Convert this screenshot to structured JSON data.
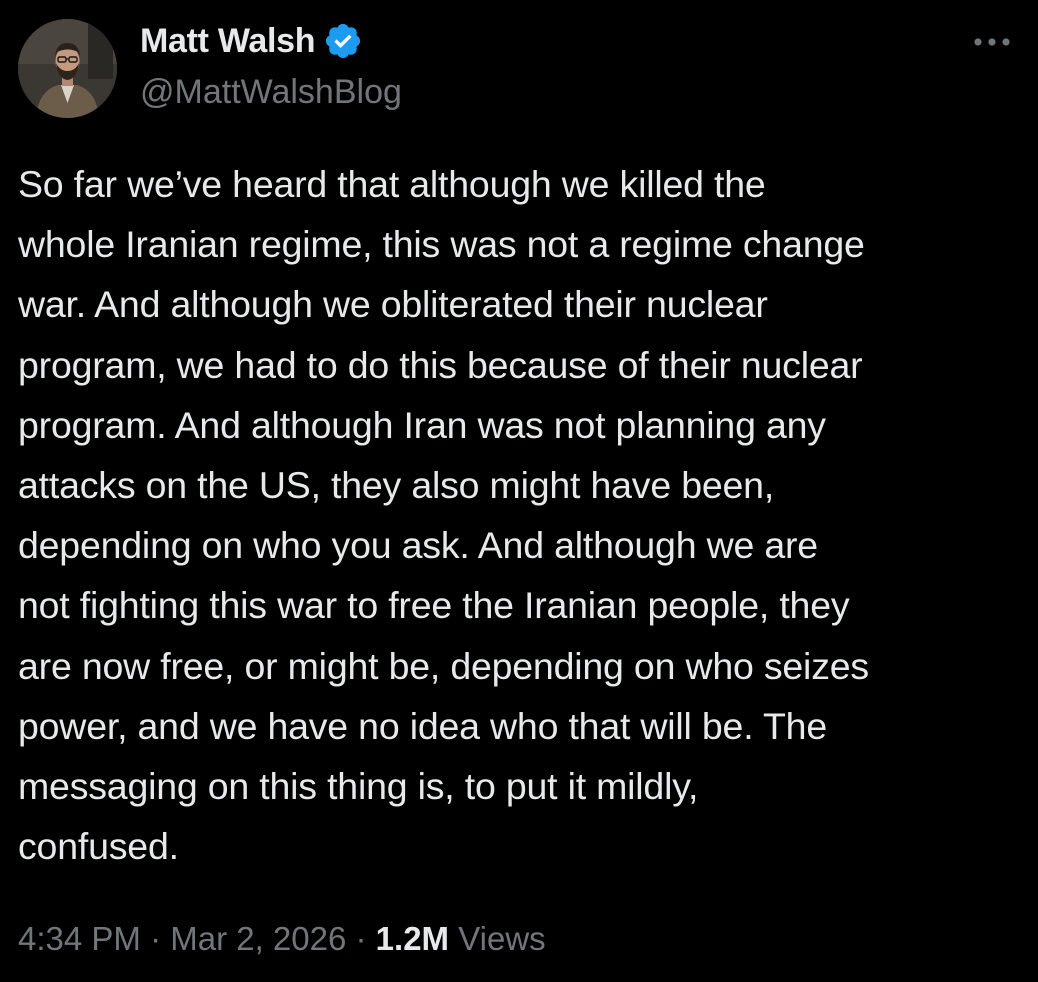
{
  "author": {
    "name": "Matt Walsh",
    "handle": "@MattWalshBlog",
    "verified_color": "#1d9bf0"
  },
  "tweet": {
    "lines": [
      "So far we’ve heard that although we killed the",
      "whole Iranian regime, this was not a regime change",
      "war. And although we obliterated their nuclear",
      "program, we had to do this because of their nuclear",
      "program. And although Iran was not planning any",
      "attacks on the US, they also might have been,",
      "depending on who you ask. And although we are",
      "not fighting this war to free the Iranian people, they",
      "are now free, or might be, depending on who seizes",
      "power, and we have no idea who that will be. The",
      "messaging on this thing is, to put it mildly,",
      "confused."
    ]
  },
  "meta": {
    "time": "4:34 PM",
    "separator": " · ",
    "date": "Mar 2, 2026",
    "views_count": "1.2M",
    "views_label": "Views"
  },
  "icons": {
    "more": "more-options-icon",
    "verified": "verified-badge-icon"
  },
  "colors": {
    "background": "#000000",
    "text_primary": "#e7e9ea",
    "text_secondary": "#71767b"
  }
}
